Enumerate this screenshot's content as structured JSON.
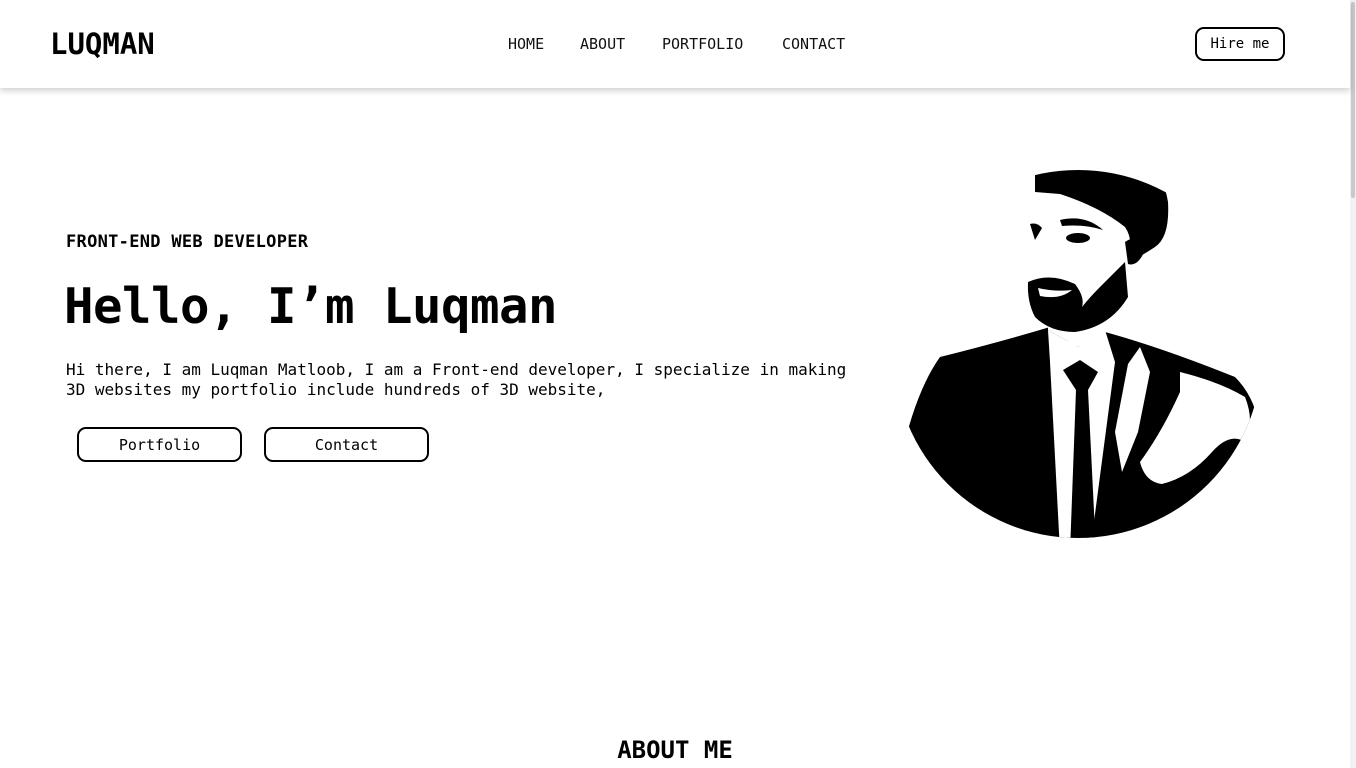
{
  "header": {
    "logo": "LUQMAN",
    "nav": [
      "HOME",
      "ABOUT",
      "PORTFOLIO",
      "CONTACT"
    ],
    "hire_label": "Hire me"
  },
  "hero": {
    "subtitle": "FRONT-END WEB DEVELOPER",
    "headline": "Hello, I’m Luqman",
    "intro": "Hi there, I am Luqman Matloob, I am a Front-end developer, I specialize in making 3D websites my portfolio include hundreds of 3D website,",
    "buttons": [
      "Portfolio",
      "Contact"
    ],
    "portrait_icon": "developer-portrait-illustration"
  },
  "about": {
    "title": "ABOUT ME"
  }
}
